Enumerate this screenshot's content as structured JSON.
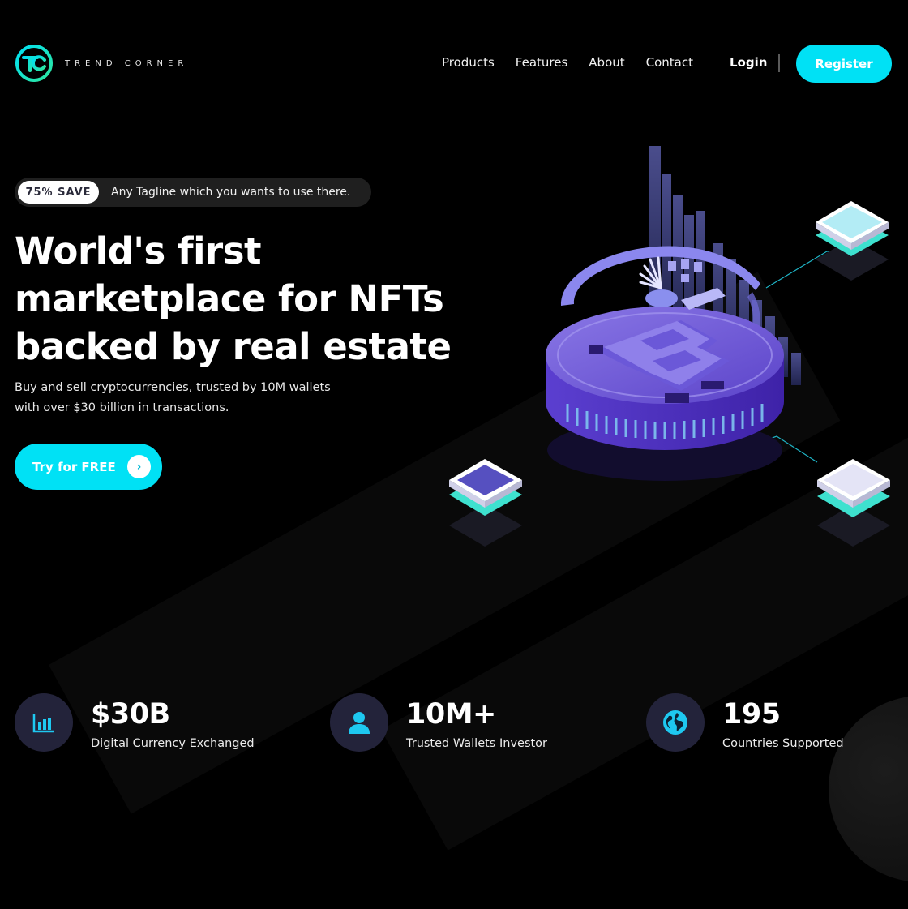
{
  "brand": {
    "name": "TREND CORNER",
    "accent": "#00e1f5",
    "logo_colors": [
      "#00e1f5",
      "#2ee59d"
    ]
  },
  "nav": {
    "items": [
      {
        "label": "Products"
      },
      {
        "label": "Features"
      },
      {
        "label": "About"
      },
      {
        "label": "Contact"
      }
    ],
    "login_label": "Login",
    "register_label": "Register"
  },
  "hero": {
    "badge": "75% SAVE",
    "tagline": "Any Tagline which you wants to use there.",
    "headline_lines": [
      "World's first",
      "marketplace for NFTs",
      "backed by real estate"
    ],
    "sub_lines": [
      "Buy and sell cryptocurrencies, trusted by 10M wallets",
      "with over $30 billion in transactions."
    ],
    "cta_label": "Try for FREE",
    "cta_icon": "chevron-right-icon",
    "illustration_icon": "bitcoin-coin-icon"
  },
  "stats": [
    {
      "value": "$30B",
      "label": "Digital Currency Exchanged",
      "icon": "bar-chart-icon"
    },
    {
      "value": "10M+",
      "label": "Trusted Wallets Investor",
      "icon": "user-icon"
    },
    {
      "value": "195",
      "label": "Countries Supported",
      "icon": "globe-icon"
    }
  ]
}
